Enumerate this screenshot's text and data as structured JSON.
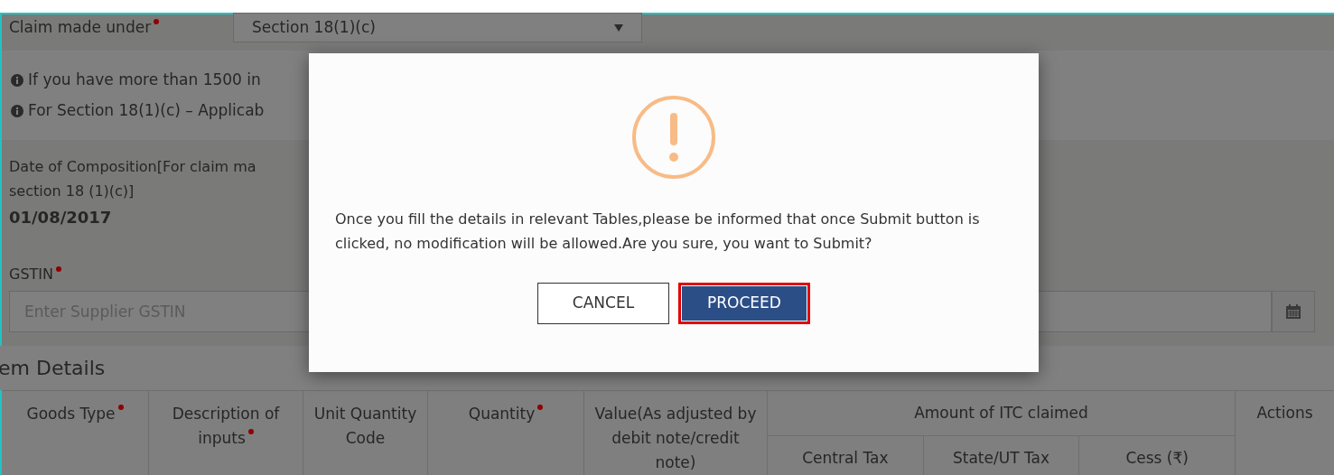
{
  "claim": {
    "label": "Claim made under",
    "required": true,
    "value": "Section 18(1)(c)"
  },
  "notes": [
    "If you have more than 1500 in",
    "For Section 18(1)(c) – Applicab"
  ],
  "composition": {
    "label": "Date of Composition[For claim ma",
    "label_line_2": "section 18 (1)(c)]",
    "value": "01/08/2017"
  },
  "gstin": {
    "label": "GSTIN",
    "required": true,
    "placeholder": "Enter Supplier GSTIN"
  },
  "section_title": "em Details",
  "table": {
    "columns": [
      {
        "label": "Goods Type",
        "required": true
      },
      {
        "label": "Description of inputs",
        "required": true
      },
      {
        "label": "Unit Quantity Code",
        "required": false
      },
      {
        "label": "Quantity",
        "required": true
      },
      {
        "label": "Value(As adjusted by debit note/credit note)",
        "required": false
      }
    ],
    "group": {
      "label": "Amount of ITC claimed",
      "columns": [
        "Central Tax",
        "State/UT Tax",
        "Cess (₹)"
      ]
    },
    "actions": "Actions"
  },
  "modal": {
    "message": "Once you fill the details in relevant Tables,please be informed that once Submit button is clicked, no modification will be allowed.Are you sure, you want to Submit?",
    "buttons": [
      {
        "label": "CANCEL",
        "kind": "secondary",
        "highlighted": false
      },
      {
        "label": "PROCEED",
        "kind": "primary",
        "highlighted": true
      }
    ]
  }
}
